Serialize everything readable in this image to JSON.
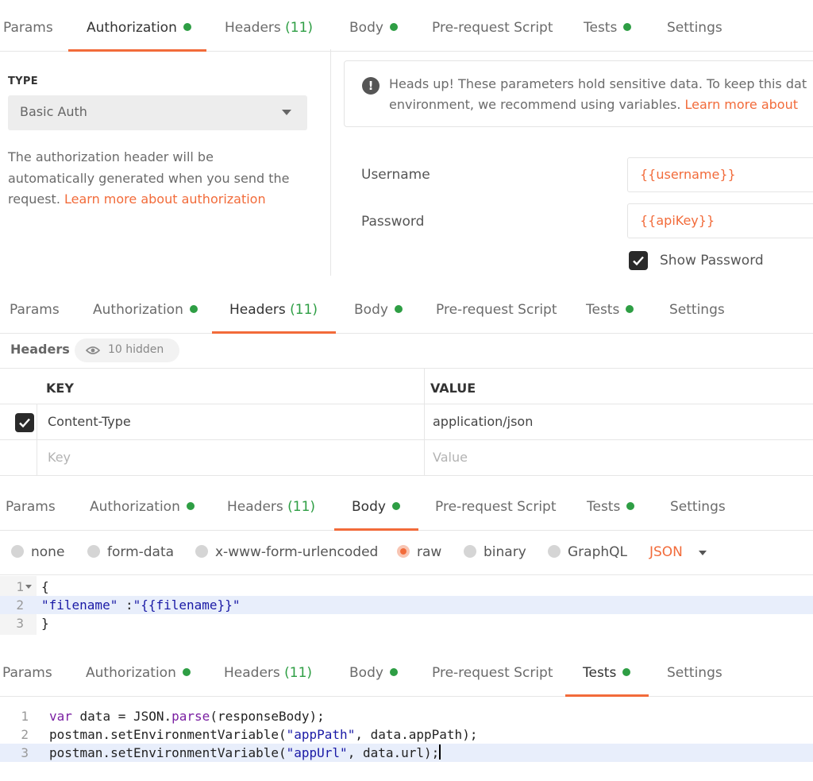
{
  "tab_labels": {
    "params": "Params",
    "authorization": "Authorization",
    "headers": "Headers",
    "headers_count": "(11)",
    "body": "Body",
    "prerequest": "Pre-request Script",
    "tests": "Tests",
    "settings": "Settings"
  },
  "colors": {
    "accent": "#f26b3a",
    "status_dot": "#2e9e44"
  },
  "auth_panel": {
    "active_tab": "authorization",
    "type_label": "TYPE",
    "type_value": "Basic Auth",
    "description_line1": "The authorization header will be",
    "description_line2": "automatically generated when you send the",
    "description_line3_prefix": "request. ",
    "description_link": "Learn more about authorization",
    "notice_line1": "Heads up! These parameters hold sensitive data. To keep this dat",
    "notice_line2_prefix": "environment, we recommend using variables. ",
    "notice_link": "Learn more about",
    "username_label": "Username",
    "username_value": "{{username}}",
    "password_label": "Password",
    "password_value": "{{apiKey}}",
    "show_password_label": "Show Password",
    "show_password_checked": true
  },
  "headers_panel": {
    "active_tab": "headers",
    "title": "Headers",
    "hidden_badge": "10 hidden",
    "columns": [
      "KEY",
      "VALUE"
    ],
    "rows": [
      {
        "checked": true,
        "key": "Content-Type",
        "value": "application/json"
      }
    ],
    "placeholder_key": "Key",
    "placeholder_value": "Value"
  },
  "body_panel": {
    "active_tab": "body",
    "body_types": [
      "none",
      "form-data",
      "x-www-form-urlencoded",
      "raw",
      "binary",
      "GraphQL"
    ],
    "selected_type": "raw",
    "format": "JSON",
    "code_lines": [
      {
        "n": "1",
        "text": "{"
      },
      {
        "n": "2",
        "key": "\"filename\"",
        "sep": " :",
        "value": "\"{{filename}}\""
      },
      {
        "n": "3",
        "text": "}"
      }
    ]
  },
  "tests_panel": {
    "active_tab": "tests",
    "code_lines": [
      {
        "n": "1",
        "kw": "var",
        "a": " data = JSON.",
        "fn": "parse",
        "b": "(responseBody);"
      },
      {
        "n": "2",
        "a": "postman.setEnvironmentVariable(",
        "str": "\"appPath\"",
        "b": ", data.appPath);"
      },
      {
        "n": "3",
        "a": "postman.setEnvironmentVariable(",
        "str": "\"appUrl\"",
        "b": ", data.url);"
      }
    ]
  }
}
